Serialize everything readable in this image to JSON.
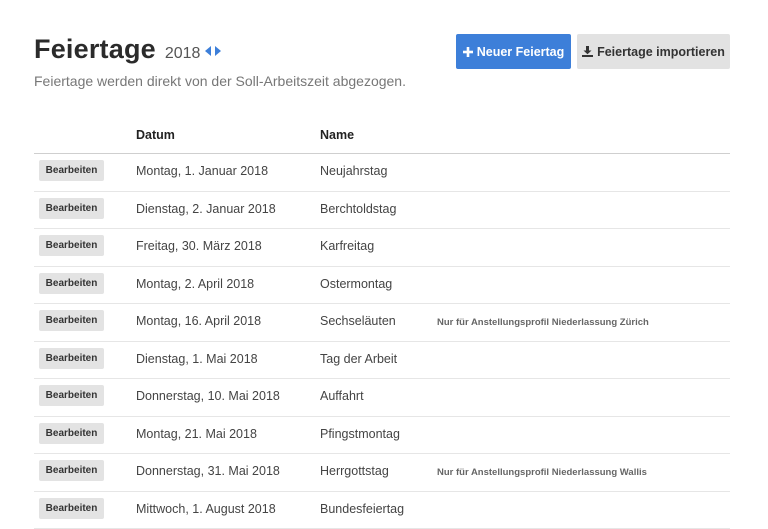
{
  "header": {
    "title": "Feiertage",
    "year": "2018",
    "subtitle": "Feiertage werden direkt von der Soll-Arbeitszeit abgezogen."
  },
  "actions": {
    "new_label": "Neuer Feiertag",
    "import_label": "Feiertage importieren"
  },
  "colors": {
    "primary": "#3d7fd9",
    "secondary": "#e2e2e2"
  },
  "icons": {
    "prev": "caret-left-icon",
    "next": "caret-right-icon",
    "new": "plus-icon",
    "import": "download-icon"
  },
  "table": {
    "columns": {
      "date": "Datum",
      "name": "Name"
    },
    "edit_label": "Bearbeiten",
    "rows": [
      {
        "date": "Montag, 1. Januar 2018",
        "name": "Neujahrstag",
        "note": ""
      },
      {
        "date": "Dienstag, 2. Januar 2018",
        "name": "Berchtoldstag",
        "note": ""
      },
      {
        "date": "Freitag, 30. März 2018",
        "name": "Karfreitag",
        "note": ""
      },
      {
        "date": "Montag, 2. April 2018",
        "name": "Ostermontag",
        "note": ""
      },
      {
        "date": "Montag, 16. April 2018",
        "name": "Sechseläuten",
        "note": "Nur für Anstellungsprofil Niederlassung Zürich"
      },
      {
        "date": "Dienstag, 1. Mai 2018",
        "name": "Tag der Arbeit",
        "note": ""
      },
      {
        "date": "Donnerstag, 10. Mai 2018",
        "name": "Auffahrt",
        "note": ""
      },
      {
        "date": "Montag, 21. Mai 2018",
        "name": "Pfingstmontag",
        "note": ""
      },
      {
        "date": "Donnerstag, 31. Mai 2018",
        "name": "Herrgottstag",
        "note": "Nur für Anstellungsprofil Niederlassung Wallis"
      },
      {
        "date": "Mittwoch, 1. August 2018",
        "name": "Bundesfeiertag",
        "note": ""
      }
    ]
  }
}
